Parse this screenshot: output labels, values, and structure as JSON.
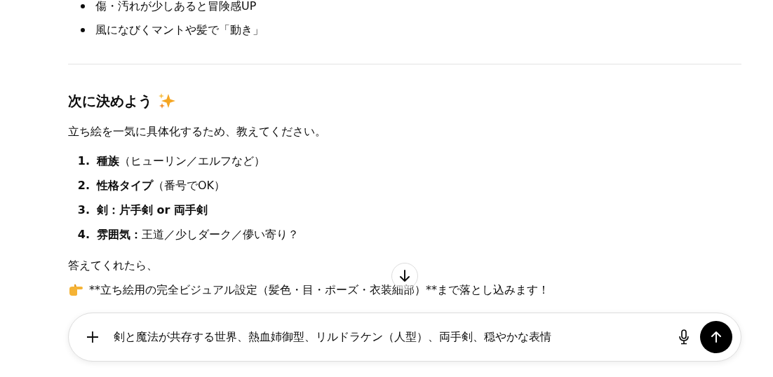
{
  "bullets": [
    "傷・汚れが少しあると冒険感UP",
    "風になびくマントや髪で「動き」"
  ],
  "section": {
    "heading": "次に決めよう",
    "intro": "立ち絵を一気に具体化するため、教えてください。",
    "questions": [
      {
        "number": "1.",
        "label": "種族",
        "detail": "（ヒューリン／エルフなど）"
      },
      {
        "number": "2.",
        "label": "性格タイプ",
        "detail": "（番号でOK）"
      },
      {
        "number": "3.",
        "label": "剣：片手剣 or 両手剣"
      },
      {
        "number": "4.",
        "label": "雰囲気：",
        "detail": "王道／少しダーク／儚い寄り？"
      }
    ],
    "closing": "答えてくれたら、",
    "pointer_line": "**立ち絵用の完全ビジュアル設定（髪色・目・ポーズ・衣装細部）**まで落とし込みます！"
  },
  "composer": {
    "value": "剣と魔法が共存する世界、熱血姉御型、リルドラケン（人型）、両手剣、穏やかな表情"
  }
}
